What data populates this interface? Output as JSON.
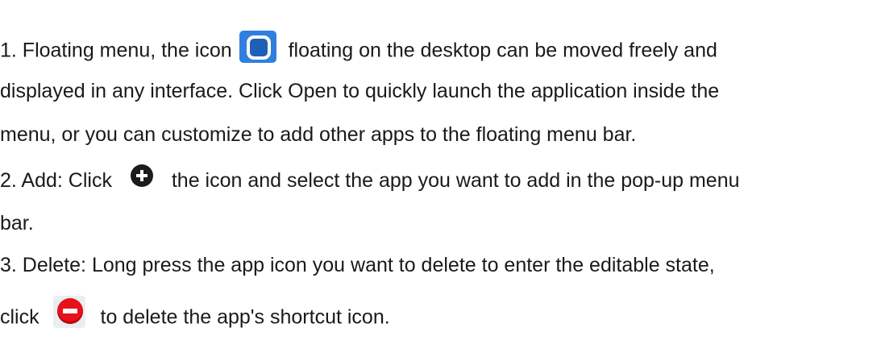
{
  "paragraphs": {
    "p1": {
      "line1_before": "1. Floating menu, the icon",
      "line1_after": "floating on the desktop can be moved freely and",
      "line2": "displayed in any interface. Click Open to quickly launch the application inside the",
      "line3": "menu, or you can customize to add other apps to the floating menu bar."
    },
    "p2": {
      "line1_before": "2. Add: Click",
      "line1_after": "the icon and select the app you want to add in the pop-up menu",
      "line2": "bar."
    },
    "p3": {
      "line1": "3. Delete: Long press the app icon you want to delete to enter the editable state,",
      "line2_before": "click",
      "line2_after": "to delete the app's shortcut icon."
    }
  },
  "icons": {
    "floating_ball": "floating-ball-icon",
    "add": "plus-circle-icon",
    "delete": "minus-circle-icon"
  },
  "colors": {
    "text": "#1a1a1a",
    "floating_ball": "#2f7fe0",
    "add": "#1c1c1c",
    "delete": "#e8101a"
  }
}
